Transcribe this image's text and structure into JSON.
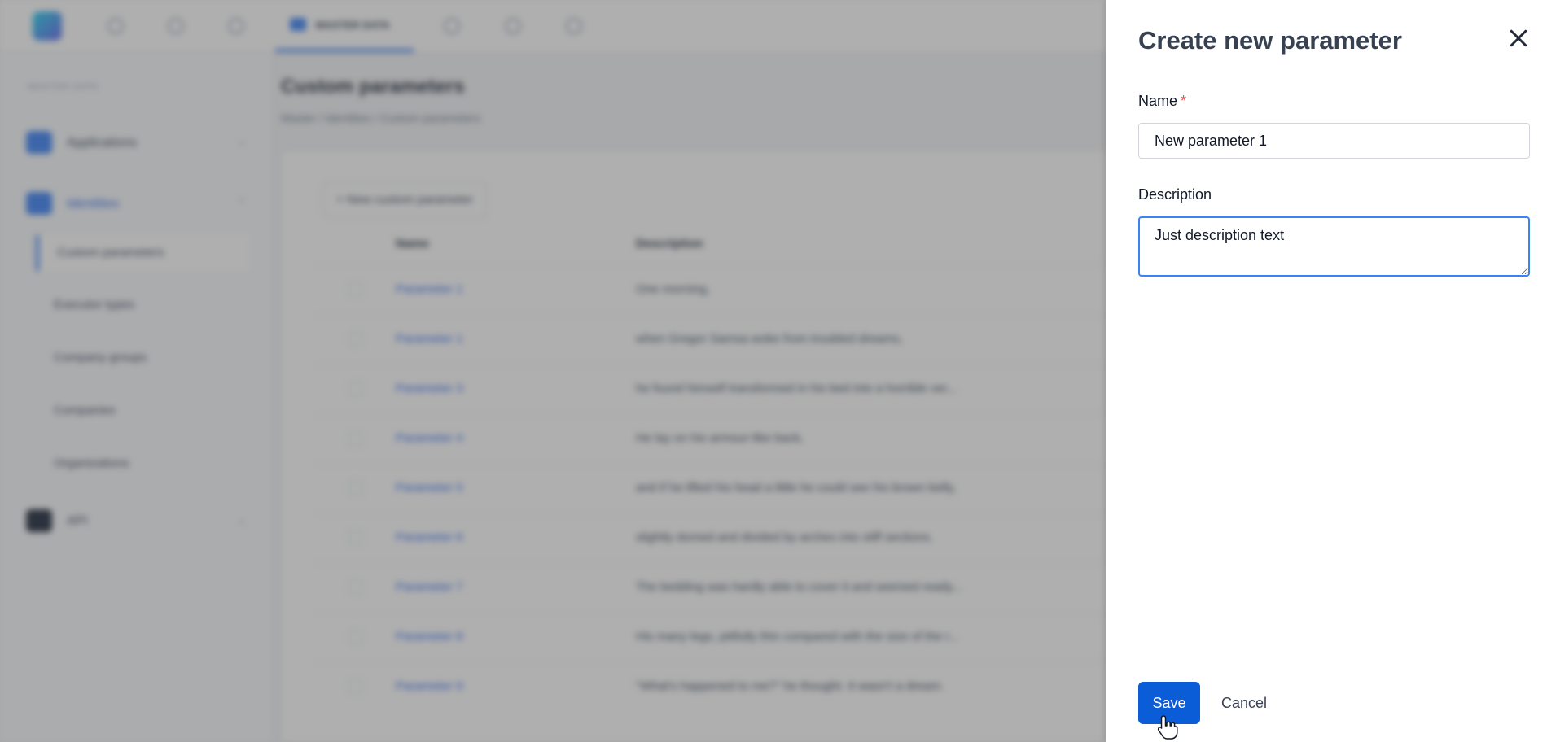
{
  "background": {
    "nav_active_label": "MASTER DATA",
    "sidebar": {
      "section_label": "MASTER DATA",
      "groups": [
        {
          "label": "Applications"
        },
        {
          "label": "Identities"
        },
        {
          "label": "API"
        }
      ],
      "items": [
        "Custom parameters",
        "Executor types",
        "Company groups",
        "Companies",
        "Organizations"
      ]
    },
    "page_title": "Custom parameters",
    "breadcrumb": "Master  /  Identities  /  Custom parameters",
    "new_button": "+ New custom parameter",
    "columns": [
      "Name",
      "Description"
    ],
    "rows": [
      {
        "name": "Parameter 1",
        "description": "One morning,"
      },
      {
        "name": "Parameter 1",
        "description": "when Gregor Samsa woke from troubled dreams,"
      },
      {
        "name": "Parameter 3",
        "description": "he found himself transformed in his bed into a horrible ver..."
      },
      {
        "name": "Parameter 4",
        "description": "He lay on his armour-like back,"
      },
      {
        "name": "Parameter 5",
        "description": "and if he lifted his head a little he could see his brown belly,"
      },
      {
        "name": "Parameter 6",
        "description": "slightly domed and divided by arches into stiff sections."
      },
      {
        "name": "Parameter 7",
        "description": "The bedding was hardly able to cover it and seemed ready..."
      },
      {
        "name": "Parameter 8",
        "description": "His many legs, pitifully thin compared with the size of the r..."
      },
      {
        "name": "Parameter 9",
        "description": "\"What's happened to me?\" he thought. It wasn't a dream."
      }
    ]
  },
  "drawer": {
    "title": "Create new parameter",
    "close_icon": "close-icon",
    "name_label": "Name",
    "required_marker": "*",
    "name_value": "New parameter 1",
    "description_label": "Description",
    "description_value": "Just description text",
    "save_label": "Save",
    "cancel_label": "Cancel"
  },
  "colors": {
    "primary": "#0b5cd7",
    "focus_border": "#3b82f6",
    "required": "#ef4444",
    "overlay": "rgba(64,64,64,0.42)"
  }
}
